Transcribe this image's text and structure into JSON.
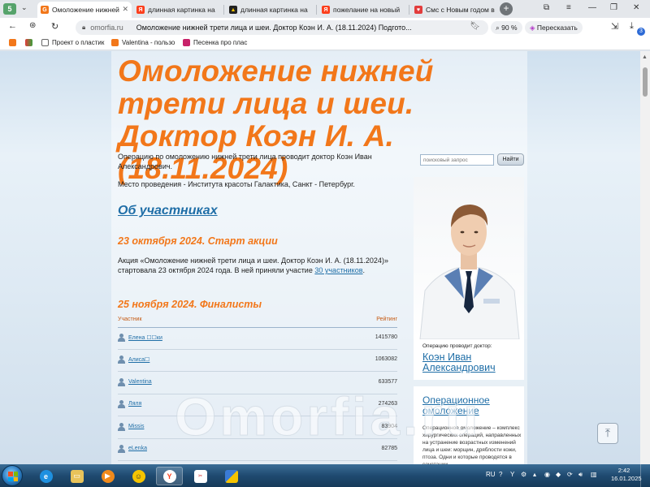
{
  "browser": {
    "tabs": [
      {
        "title": "Омоложение нижней",
        "favicon": "omorfia-icon",
        "active": true
      },
      {
        "title": "длинная картинка на",
        "favicon": "yandex-icon",
        "active": false
      },
      {
        "title": "длинная картинка на",
        "favicon": "image-icon",
        "active": false
      },
      {
        "title": "пожелание на новый",
        "favicon": "yandex-icon",
        "active": false
      },
      {
        "title": "Смс с Новым годом в",
        "favicon": "heart-icon",
        "active": false
      }
    ],
    "address": {
      "domain": "omorfia.ru",
      "page_title": "Омоложение нижней трети лица и шеи. Доктор Коэн И. А. (18.11.2024) Подгото..."
    },
    "zoom": "90 %",
    "retell_label": "Пересказать",
    "downloads_badge": "3",
    "bookmarks": [
      {
        "label": "Проект о пластик"
      },
      {
        "label": "Valentina - пользо"
      },
      {
        "label": "Песенка про плас"
      }
    ]
  },
  "page": {
    "title": "Омоложение нижней трети лица и шеи. Доктор Коэн И. А. (18.11.2024)",
    "intro": "Операцию по омоложению нижней трети лица проводит доктор Коэн Иван Александрович.",
    "venue": "Место проведения - Института красоты Галактика, Санкт - Петербург.",
    "participants_heading": "Об участниках",
    "start_heading": "23 октября 2024. Старт акции",
    "start_text_before": "Акция «Омоложение нижней трети лица и шеи. Доктор Коэн И. А. (18.11.2024)» стартовала 23 октября 2024 года. В ней приняли участие ",
    "start_text_link": "30 участников",
    "start_text_after": ".",
    "finalists_heading": "25 ноября 2024. Финалисты",
    "table": {
      "col_participant": "Участник",
      "col_rating": "Рейтинг",
      "rows": [
        {
          "name": "Елена ☐☐ки",
          "score": "1415780"
        },
        {
          "name": "Алиса☐",
          "score": "1063082"
        },
        {
          "name": "Valentina",
          "score": "633577"
        },
        {
          "name": "Ляля",
          "score": "274263"
        },
        {
          "name": "Missis",
          "score": "83904"
        },
        {
          "name": "eLenka",
          "score": "82785"
        }
      ]
    },
    "watermark": "Omorfia.ru"
  },
  "sidebar": {
    "search_placeholder": "поисковый запрос",
    "search_button": "Найти",
    "doctor_caption": "Операцию проводит доктор:",
    "doctor_name": "Коэн Иван Александрович",
    "procedure_title": "Операционное омоложение",
    "procedure_text": "Операционное омоложение – комплекс хирургических операций, направленных на устранение возрастных изменений лица и шеи: морщин, дряблости кожи, птоза. Одни и которые проводятся в сочетании"
  },
  "taskbar": {
    "lang": "RU",
    "time": "2:42",
    "date": "16.01.2025"
  },
  "colors": {
    "accent_orange": "#f2771a",
    "link_blue": "#1f6ea7"
  }
}
